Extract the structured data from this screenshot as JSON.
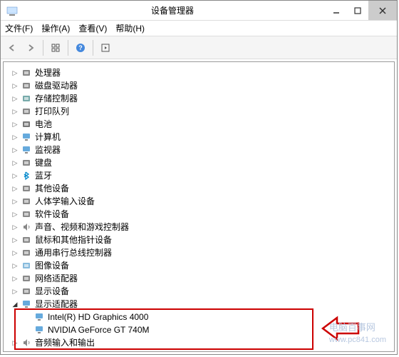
{
  "window": {
    "title": "设备管理器"
  },
  "menu": {
    "file": "文件(F)",
    "action": "操作(A)",
    "view": "查看(V)",
    "help": "帮助(H)"
  },
  "tree": {
    "items": [
      {
        "label": "处理器",
        "icon": "cpu"
      },
      {
        "label": "磁盘驱动器",
        "icon": "disk"
      },
      {
        "label": "存储控制器",
        "icon": "storage"
      },
      {
        "label": "打印队列",
        "icon": "printer"
      },
      {
        "label": "电池",
        "icon": "battery"
      },
      {
        "label": "计算机",
        "icon": "computer"
      },
      {
        "label": "监视器",
        "icon": "monitor"
      },
      {
        "label": "键盘",
        "icon": "keyboard"
      },
      {
        "label": "蓝牙",
        "icon": "bluetooth"
      },
      {
        "label": "其他设备",
        "icon": "other"
      },
      {
        "label": "人体学输入设备",
        "icon": "hid"
      },
      {
        "label": "软件设备",
        "icon": "software"
      },
      {
        "label": "声音、视频和游戏控制器",
        "icon": "audio"
      },
      {
        "label": "鼠标和其他指针设备",
        "icon": "mouse"
      },
      {
        "label": "通用串行总线控制器",
        "icon": "usb"
      },
      {
        "label": "图像设备",
        "icon": "imaging"
      },
      {
        "label": "网络适配器",
        "icon": "network"
      },
      {
        "label": "显示设备",
        "icon": "video"
      }
    ],
    "expanded": {
      "label": "显示适配器",
      "icon": "display",
      "children": [
        {
          "label": "Intel(R) HD Graphics 4000",
          "icon": "display"
        },
        {
          "label": "NVIDIA GeForce GT 740M",
          "icon": "display"
        }
      ]
    },
    "after": [
      {
        "label": "音频输入和输出",
        "icon": "audio"
      }
    ]
  },
  "watermark": "电脑百事网\nwww.pc841.com"
}
